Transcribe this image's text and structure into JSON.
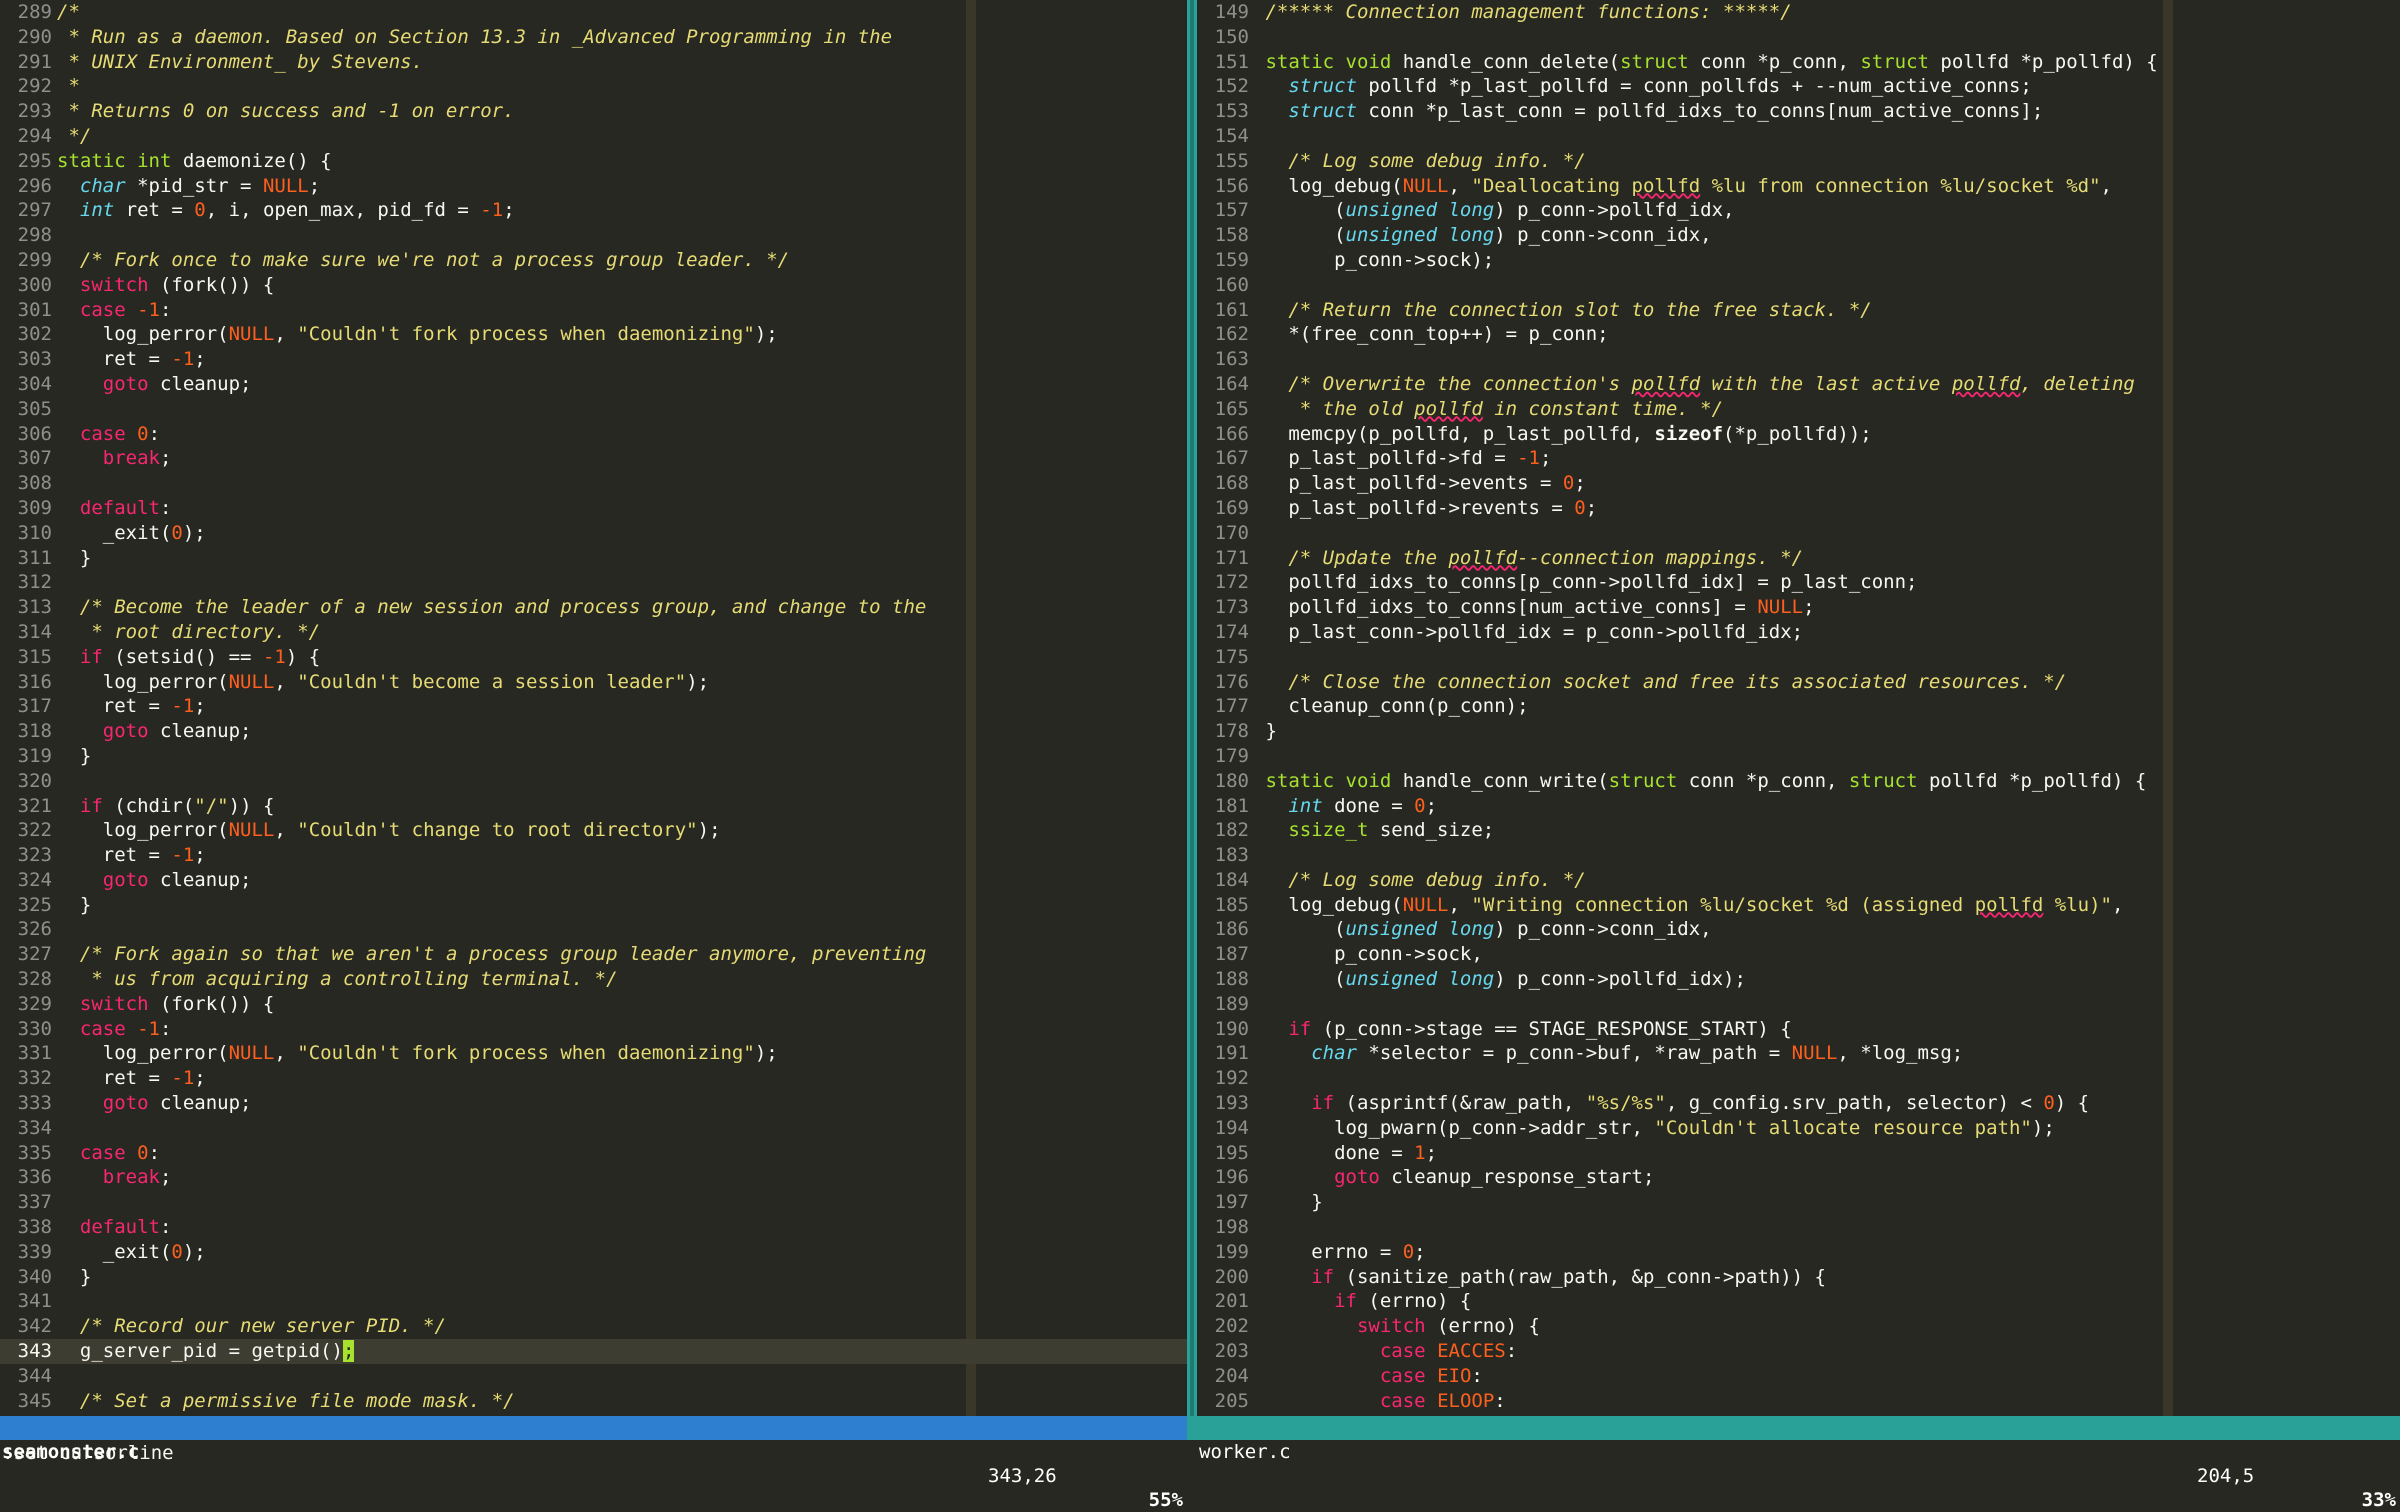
{
  "editor": "vim",
  "left_pane": {
    "filename": "seamonster.c",
    "position": "343,26",
    "percent": "55%",
    "current_line": 343
  },
  "right_pane": {
    "filename": "worker.c",
    "position": "204,5",
    "percent": "33%"
  },
  "command_line": ":set cursorline",
  "colors": {
    "background": "#272822",
    "left_status": "#2e7fd0",
    "right_status": "#2aa198",
    "keyword": "#f92672",
    "comment": "#e6db74",
    "number": "#ae81ff"
  }
}
